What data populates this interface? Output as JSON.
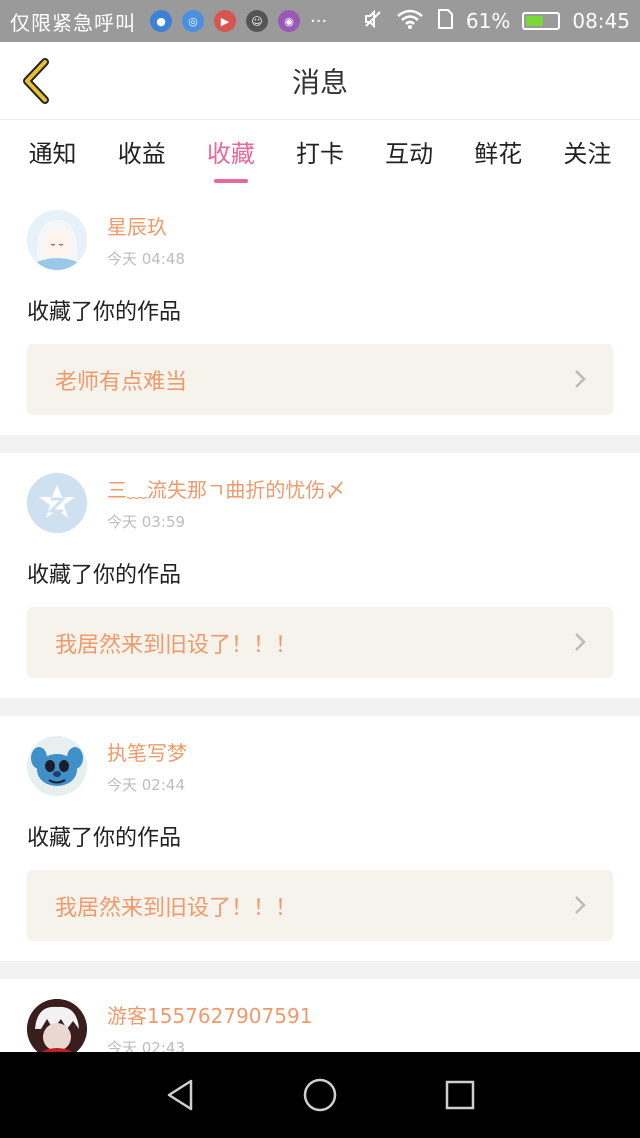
{
  "status_bar": {
    "carrier": "仅限紧急呼叫",
    "more": "···",
    "battery_percent": "61%",
    "battery_level": 0.61,
    "time": "08:45",
    "icons": [
      "app-blue-icon",
      "app-blue2-icon",
      "app-red-icon",
      "app-cat-icon",
      "app-purple-icon",
      "mute-icon",
      "wifi-icon",
      "sim-icon",
      "battery-icon"
    ]
  },
  "header": {
    "title": "消息",
    "back_icon": "back-chevron-icon",
    "accent": "#e7c130"
  },
  "tabs": [
    {
      "label": "通知",
      "active": false
    },
    {
      "label": "收益",
      "active": false
    },
    {
      "label": "收藏",
      "active": true
    },
    {
      "label": "打卡",
      "active": false
    },
    {
      "label": "互动",
      "active": false
    },
    {
      "label": "鲜花",
      "active": false
    },
    {
      "label": "关注",
      "active": false
    }
  ],
  "colors": {
    "tab_active": "#e9679a",
    "username": "#ee9a6a",
    "work_bg": "#f5f3ec"
  },
  "messages": [
    {
      "user": "星辰玖",
      "time": "今天 04:48",
      "action": "收藏了你的作品",
      "work": "老师有点难当",
      "avatar": "anime-girl-avatar"
    },
    {
      "user": "三﹏流失那ㄱ曲折的忧伤〆",
      "time": "今天 03:59",
      "action": "收藏了你的作品",
      "work": "我居然来到旧设了！！！",
      "avatar": "default-avatar"
    },
    {
      "user": "执笔写梦",
      "time": "今天 02:44",
      "action": "收藏了你的作品",
      "work": "我居然来到旧设了！！！",
      "avatar": "stitch-avatar"
    },
    {
      "user": "游客1557627907591",
      "time": "今天 02:43",
      "action": "",
      "work": "",
      "avatar": "dark-anime-avatar"
    }
  ],
  "nav": [
    "back-triangle-icon",
    "home-circle-icon",
    "recents-square-icon"
  ]
}
